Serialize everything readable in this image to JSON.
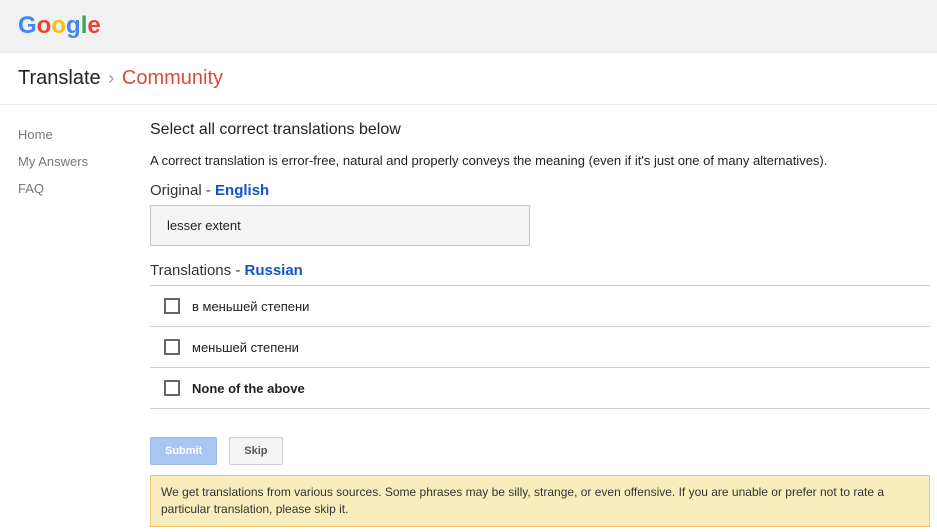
{
  "logo": {
    "g1": "G",
    "o1": "o",
    "o2": "o",
    "g2": "g",
    "l": "l",
    "e": "e"
  },
  "breadcrumb": {
    "product": "Translate",
    "sep": "›",
    "section": "Community"
  },
  "sidebar": {
    "items": [
      {
        "label": "Home"
      },
      {
        "label": "My Answers"
      },
      {
        "label": "FAQ"
      }
    ]
  },
  "task": {
    "title": "Select all correct translations below",
    "help": "A correct translation is error-free, natural and properly conveys the meaning (even if it's just one of many alternatives)."
  },
  "original": {
    "label_prefix": "Original - ",
    "language": "English",
    "text": "lesser extent"
  },
  "translations": {
    "label_prefix": "Translations - ",
    "language": "Russian",
    "options": [
      {
        "text": "в меньшей степени",
        "none": false
      },
      {
        "text": "меньшей степени",
        "none": false
      },
      {
        "text": "None of the above",
        "none": true
      }
    ]
  },
  "buttons": {
    "submit": "Submit",
    "skip": "Skip"
  },
  "notice": "We get translations from various sources. Some phrases may be silly, strange, or even offensive. If you are unable or prefer not to rate a particular translation, please skip it."
}
